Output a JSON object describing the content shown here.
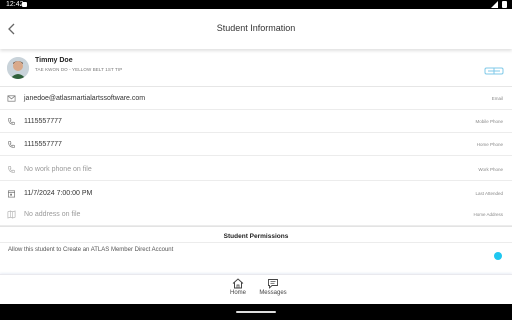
{
  "status_bar": {
    "time": "12:42"
  },
  "header": {
    "title": "Student Information"
  },
  "student": {
    "name": "Timmy Doe",
    "rank": "TAE KWON DO - YELLOW BELT 1ST TIP"
  },
  "details": [
    {
      "icon": "email-icon",
      "value": "janedoe@atlasmartialartssoftware.com",
      "label": "Email",
      "empty": false
    },
    {
      "icon": "phone-icon",
      "value": "1115557777",
      "label": "Mobile Phone",
      "empty": false
    },
    {
      "icon": "phone-icon",
      "value": "1115557777",
      "label": "Home Phone",
      "empty": false
    },
    {
      "icon": "phone-icon",
      "value": "No work phone on file",
      "label": "Work Phone",
      "empty": true
    },
    {
      "icon": "calendar-icon",
      "value": "11/7/2024 7:00:00 PM",
      "label": "Last Attended",
      "empty": false
    },
    {
      "icon": "map-icon",
      "value": "No address on file",
      "label": "Home Address",
      "empty": true
    }
  ],
  "permissions": {
    "title": "Student Permissions",
    "option_label": "Allow this student to Create an ATLAS Member Direct Account",
    "option_enabled": true
  },
  "bottom_nav": {
    "home_label": "Home",
    "messages_label": "Messages"
  },
  "colors": {
    "accent": "#1fc7f0",
    "badge": "#7fc9e8"
  }
}
